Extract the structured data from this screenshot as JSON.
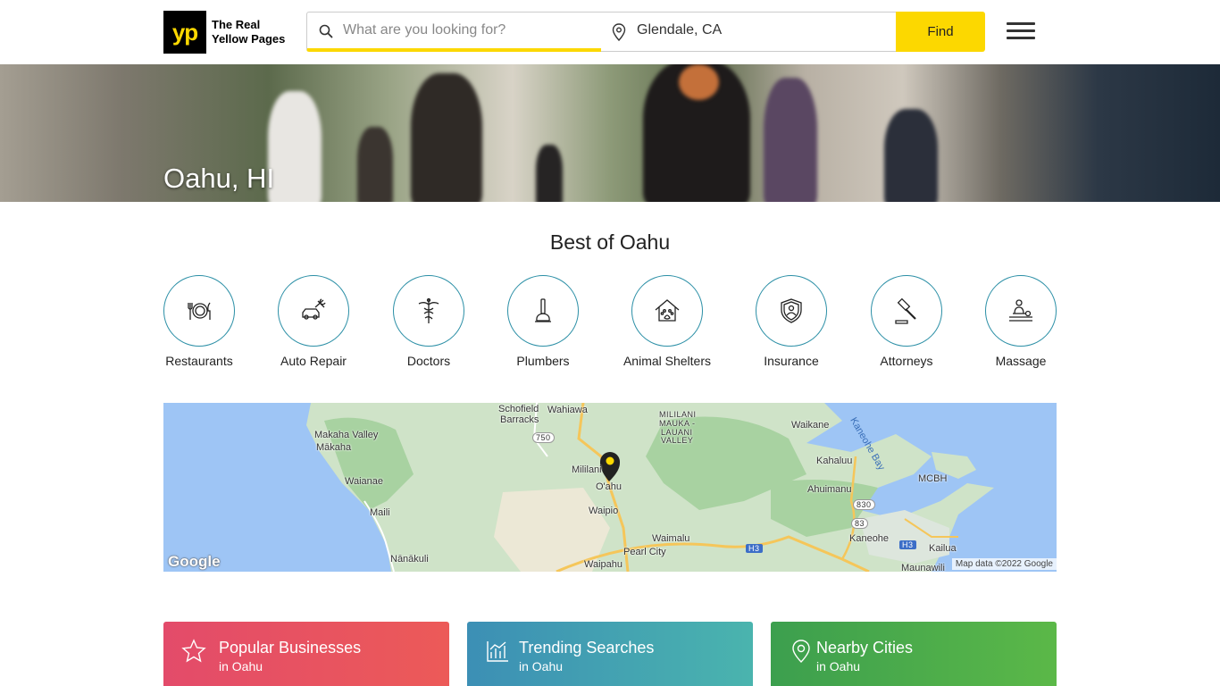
{
  "header": {
    "logo_mark": "yp",
    "logo_line1": "The Real",
    "logo_line2": "Yellow Pages",
    "search_placeholder": "What are you looking for?",
    "location_value": "Glendale, CA",
    "find_label": "Find",
    "accent_color": "#fcd800"
  },
  "hero": {
    "title": "Oahu, HI"
  },
  "best": {
    "title": "Best of Oahu",
    "categories": [
      {
        "label": "Restaurants",
        "icon": "restaurant-icon"
      },
      {
        "label": "Auto Repair",
        "icon": "auto-repair-icon"
      },
      {
        "label": "Doctors",
        "icon": "caduceus-icon"
      },
      {
        "label": "Plumbers",
        "icon": "plunger-icon"
      },
      {
        "label": "Animal Shelters",
        "icon": "animal-shelter-icon"
      },
      {
        "label": "Insurance",
        "icon": "shield-icon"
      },
      {
        "label": "Attorneys",
        "icon": "gavel-icon"
      },
      {
        "label": "Massage",
        "icon": "massage-icon"
      }
    ]
  },
  "map": {
    "labels": [
      "Schofield",
      "Barracks",
      "Wahiawa",
      "MILILANI",
      "MAUKA -",
      "LAUANI",
      "VALLEY",
      "Makaha Valley",
      "Mākaha",
      "Waikane",
      "Kaneohe Bay",
      "Kahaluu",
      "Mililani",
      "O'ahu",
      "Waianae",
      "Ahuimanu",
      "MCBH",
      "Waipio",
      "Maili",
      "Kaneohe",
      "Waimalu",
      "Kailua",
      "Pearl City",
      "Nānākuli",
      "Waipahu",
      "Maunawili",
      "750",
      "830",
      "83",
      "H3",
      "H3"
    ],
    "google_label": "Google",
    "attribution": "Map data ©2022 Google"
  },
  "cards": [
    {
      "title": "Popular Businesses",
      "sub": "in Oahu",
      "icon": "star-icon"
    },
    {
      "title": "Trending Searches",
      "sub": "in Oahu",
      "icon": "trending-chart-icon"
    },
    {
      "title": "Nearby Cities",
      "sub": "in Oahu",
      "icon": "location-pin-icon"
    }
  ]
}
